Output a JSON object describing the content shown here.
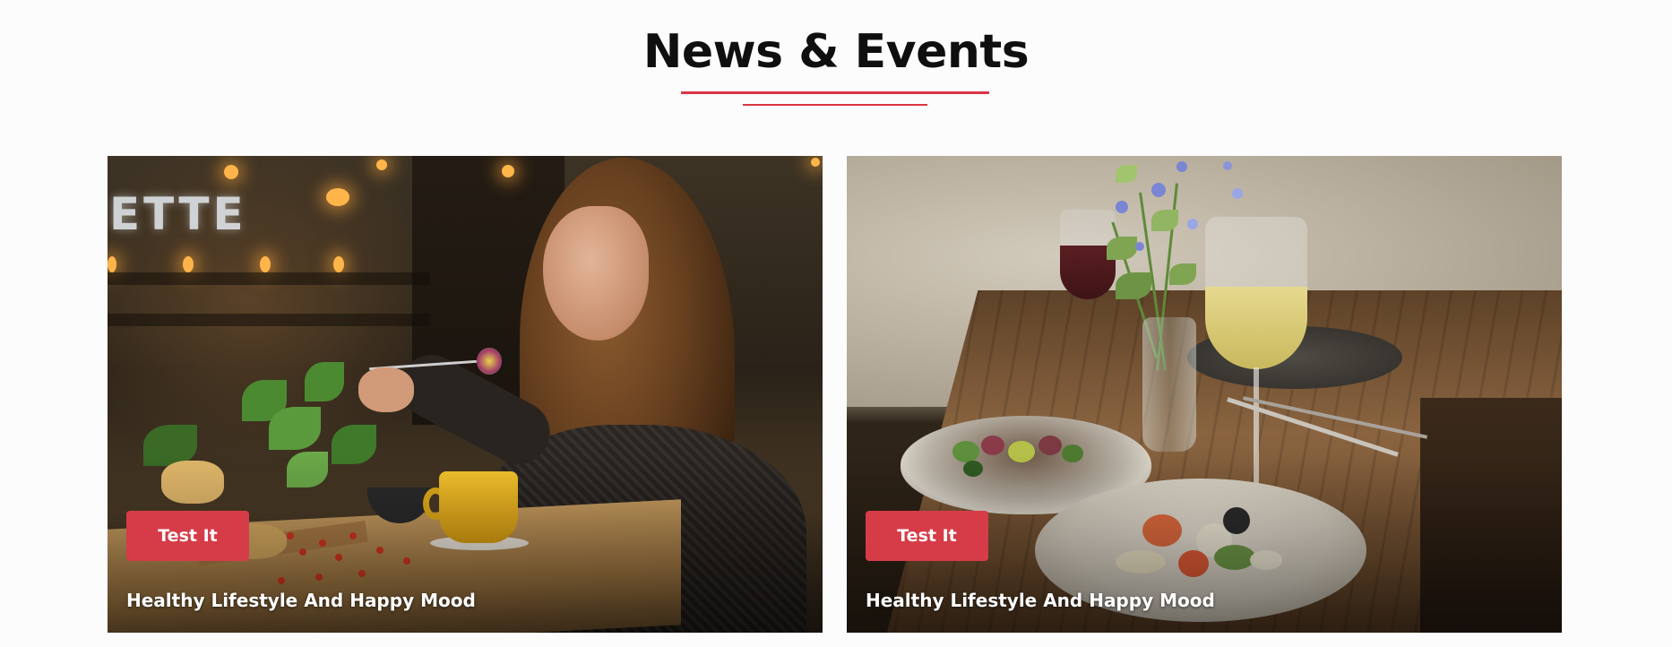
{
  "section": {
    "title": "News & Events",
    "accent_color": "#dc3545"
  },
  "cards": [
    {
      "button_label": "Test It",
      "title": "Healthy Lifestyle And Happy Mood",
      "image_description_icon": "photo-woman-eating-cafe"
    },
    {
      "button_label": "Test It",
      "title": "Healthy Lifestyle And Happy Mood",
      "image_description_icon": "photo-dining-table-wine"
    }
  ],
  "photo1": {
    "sign_text": "ETTE"
  }
}
